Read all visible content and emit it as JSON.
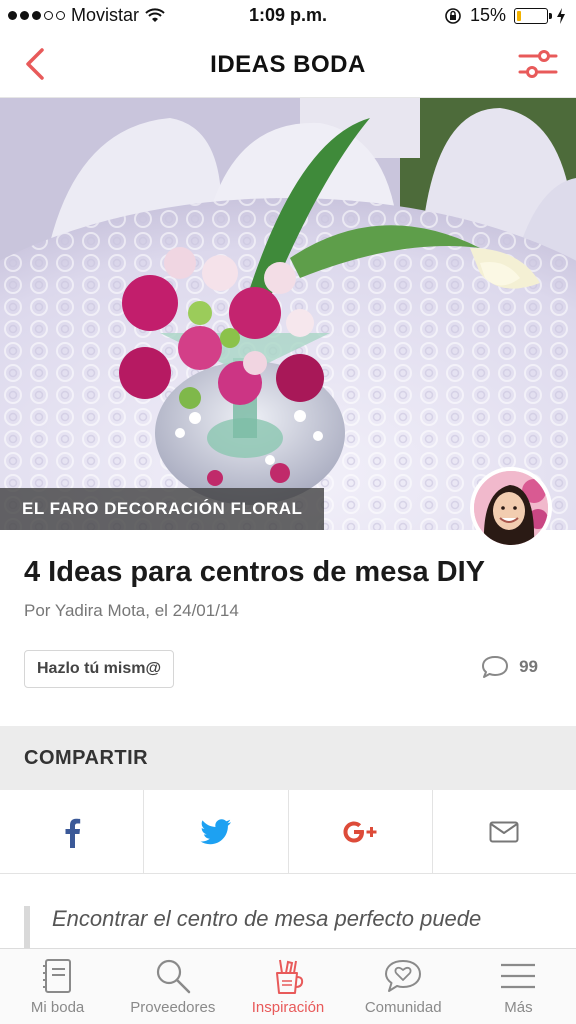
{
  "status_bar": {
    "carrier": "Movistar",
    "time": "1:09 p.m.",
    "battery_percent": "15%",
    "battery_level": 0.15
  },
  "header": {
    "title": "IDEAS BODA",
    "back_icon": "chevron-left-icon",
    "filter_icon": "sliders-icon"
  },
  "hero": {
    "credit": "EL FARO DECORACIÓN FLORAL"
  },
  "article": {
    "title": "4 Ideas para centros de mesa DIY",
    "byline": "Por Yadira Mota, el 24/01/14",
    "tag": "Hazlo tú mism@",
    "comment_count": "99"
  },
  "share": {
    "label": "COMPARTIR",
    "buttons": [
      {
        "icon": "facebook-icon",
        "color": "#3b5998"
      },
      {
        "icon": "twitter-icon",
        "color": "#1da1f2"
      },
      {
        "icon": "google-plus-icon",
        "color": "#dd4b39"
      },
      {
        "icon": "email-icon",
        "color": "#777777"
      }
    ]
  },
  "body": {
    "quote": "Encontrar el centro de mesa perfecto puede"
  },
  "tabs": [
    {
      "label": "Mi boda",
      "icon": "notebook-icon"
    },
    {
      "label": "Proveedores",
      "icon": "search-icon"
    },
    {
      "label": "Inspiración",
      "icon": "inspiration-icon",
      "active": true
    },
    {
      "label": "Comunidad",
      "icon": "community-icon"
    },
    {
      "label": "Más",
      "icon": "menu-icon"
    }
  ],
  "colors": {
    "accent": "#e85a5a",
    "facebook": "#3b5998",
    "twitter": "#1da1f2",
    "google_plus": "#dd4b39"
  }
}
